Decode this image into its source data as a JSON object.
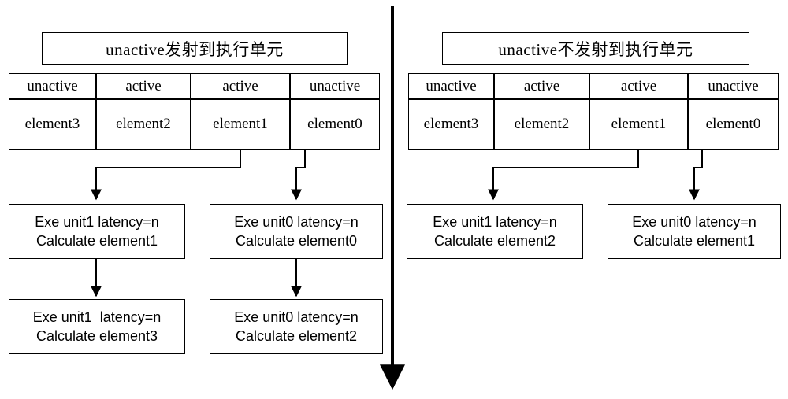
{
  "diagram": {
    "type": "flow-diagram",
    "panels": [
      {
        "id": "left",
        "title": "unactive发射到执行单元",
        "status_row": [
          "unactive",
          "active",
          "active",
          "unactive"
        ],
        "element_row": [
          "element3",
          "element2",
          "element1",
          "element0"
        ],
        "exe_stage1": [
          {
            "line1": "Exe unit1 latency=n",
            "line2": "Calculate element1"
          },
          {
            "line1": "Exe unit0 latency=n",
            "line2": "Calculate element0"
          }
        ],
        "exe_stage2": [
          {
            "line1": "Exe unit1  latency=n",
            "line2": "Calculate element3"
          },
          {
            "line1": "Exe unit0 latency=n",
            "line2": "Calculate element2"
          }
        ]
      },
      {
        "id": "right",
        "title": "unactive不发射到执行单元",
        "status_row": [
          "unactive",
          "active",
          "active",
          "unactive"
        ],
        "element_row": [
          "element3",
          "element2",
          "element1",
          "element0"
        ],
        "exe_stage1": [
          {
            "line1": "Exe unit1 latency=n",
            "line2": "Calculate element2"
          },
          {
            "line1": "Exe unit0 latency=n",
            "line2": "Calculate element1"
          }
        ],
        "exe_stage2": []
      }
    ],
    "divider": {
      "name": "vertical-time-arrow",
      "color": "#000000"
    }
  }
}
